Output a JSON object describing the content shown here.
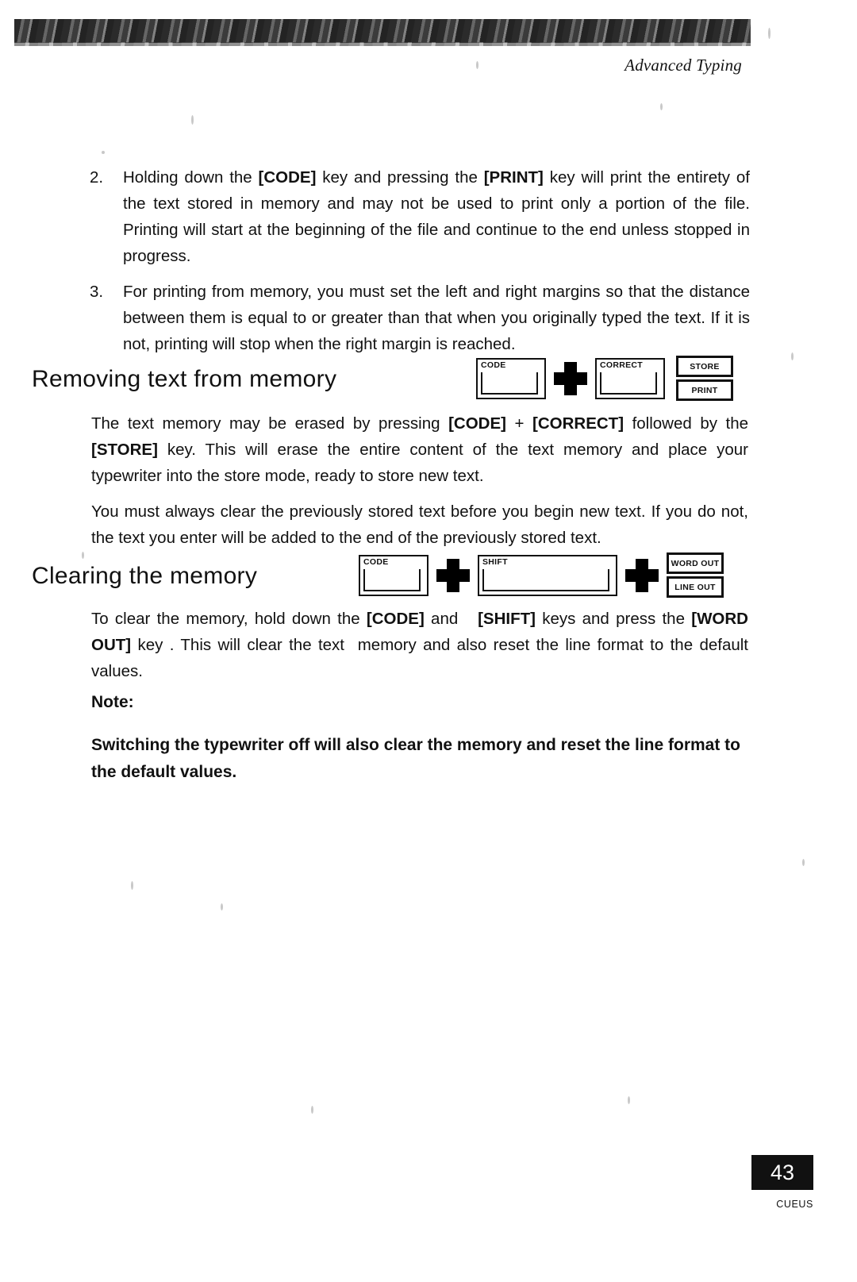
{
  "header": {
    "running_title": "Advanced Typing"
  },
  "list_items": [
    {
      "number": "2.",
      "text_html": "Holding down the <b>[CODE]</b> key and pressing the <b>[PRINT]</b> key will print the entirety of the text stored in memory and may not be used to print only a portion of the file. Printing will start at the beginning of the file and continue to the end unless stopped in progress."
    },
    {
      "number": "3.",
      "text_html": "For printing from memory, you must set the left and right margins so that the distance between them is equal to or greater than that when you originally typed the text. If it is not, printing will stop when the right margin is reached."
    }
  ],
  "sections": [
    {
      "heading": "Removing text from memory",
      "paragraphs": [
        "The text memory may be erased by pressing <b>[CODE]</b> + <b>[CORRECT]</b> followed by the <b>[STORE]</b> key. This will erase the entire content of the text memory and place your typewriter into the store mode, ready to store new text.",
        "You must always clear the previously stored text before you begin new text. If you do not, the text you enter will be added to the end of the previously stored text."
      ],
      "key_diagram": {
        "keys": [
          "CODE",
          "CORRECT"
        ],
        "stacked_key": [
          "STORE",
          "PRINT"
        ],
        "operator": "+"
      }
    },
    {
      "heading": "Clearing the memory",
      "paragraphs": [
        "To clear the memory, hold down the <b>[CODE]</b> and&nbsp;&nbsp; <b>[SHIFT]</b> keys and press the <b>[WORD OUT]</b> key . This will clear the text&nbsp; memory and also reset the line format to the default values."
      ],
      "key_diagram": {
        "keys": [
          "CODE",
          "SHIFT"
        ],
        "stacked_key": [
          "WORD OUT",
          "LINE OUT"
        ],
        "operator": "+"
      }
    }
  ],
  "note": {
    "label": "Note:",
    "text": "Switching the typewriter off will also clear the memory and reset the line format to the default values."
  },
  "footer": {
    "page_number": "43",
    "code": "CUEUS"
  }
}
